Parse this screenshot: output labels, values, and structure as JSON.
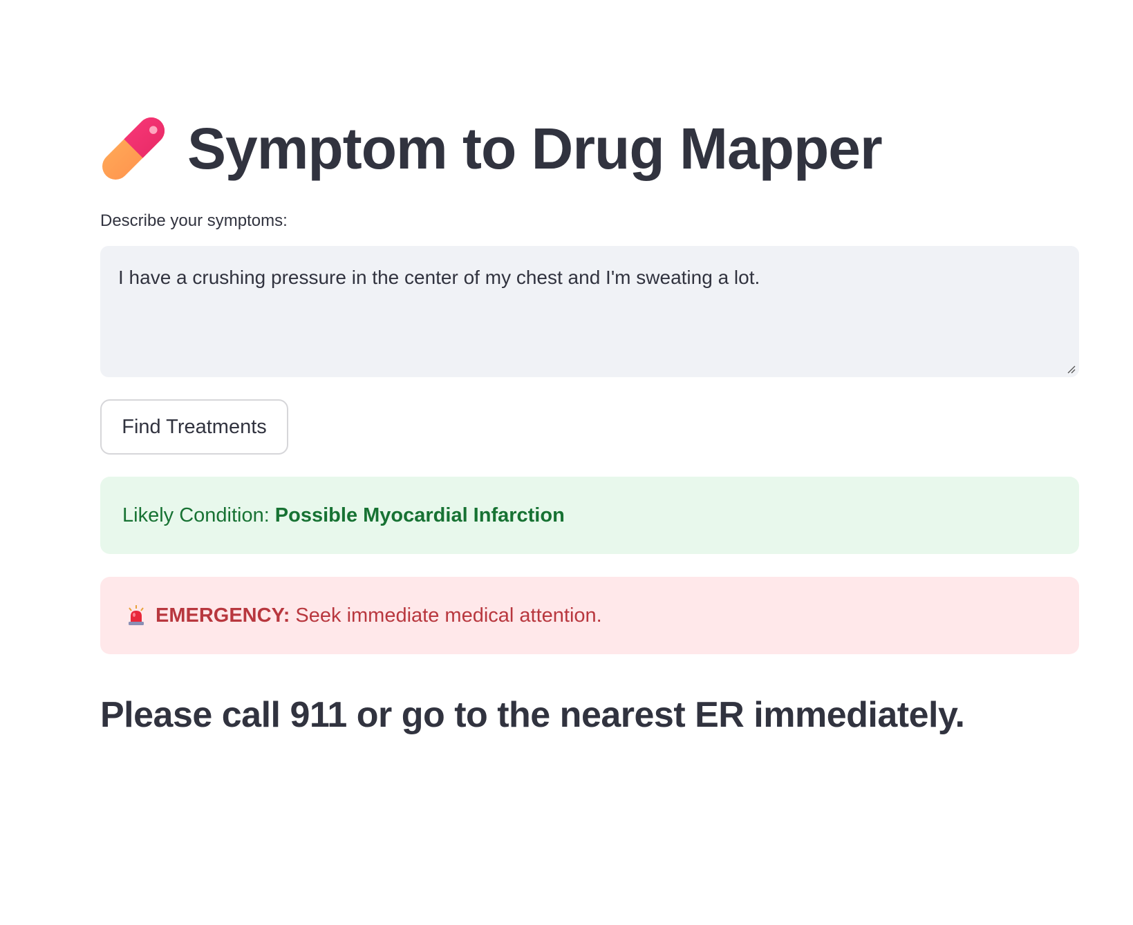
{
  "header": {
    "title": "Symptom to Drug Mapper",
    "icon": "pill-icon"
  },
  "form": {
    "label": "Describe your symptoms:",
    "symptom_value": "I have a crushing pressure in the center of my chest and I'm sweating a lot.",
    "submit_label": "Find Treatments"
  },
  "result": {
    "condition_label": "Likely Condition:",
    "condition_value": "Possible Myocardial Infarction",
    "emergency_icon": "siren-icon",
    "emergency_label": "EMERGENCY:",
    "emergency_message": "Seek immediate medical attention.",
    "call_message": "Please call 911 or go to the nearest ER immediately."
  },
  "colors": {
    "text": "#31333f",
    "input_bg": "#f0f2f6",
    "success_bg": "#e8f8ec",
    "success_text": "#177233",
    "error_bg": "#ffe8ea",
    "error_text": "#b8373e"
  }
}
